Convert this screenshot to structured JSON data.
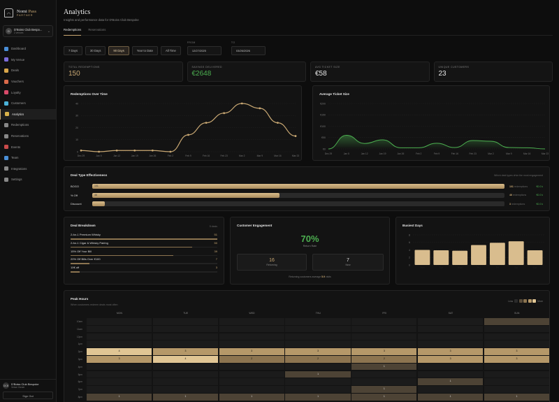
{
  "brand": {
    "name_a": "Nomi",
    "name_b": "Pass",
    "tag": "PARTNER"
  },
  "club": {
    "name": "D'Boiss Club Bespo...",
    "sub": "2 venues",
    "avatar": "D"
  },
  "nav": [
    {
      "label": "Dashboard",
      "color": "#4a8fd8"
    },
    {
      "label": "My Venue",
      "color": "#7b6cd9"
    },
    {
      "label": "Deals",
      "color": "#d9a64a"
    },
    {
      "label": "Vouchers",
      "color": "#d96a4a"
    },
    {
      "label": "Loyalty",
      "color": "#d94a6a"
    },
    {
      "label": "Customers",
      "color": "#4ab2d9"
    },
    {
      "label": "Analytics",
      "color": "#d9b24a",
      "active": true
    },
    {
      "label": "Redemptions",
      "color": "#888"
    },
    {
      "label": "Reservations",
      "color": "#888"
    },
    {
      "label": "Events",
      "color": "#c94a4a"
    },
    {
      "label": "Team",
      "color": "#4a8fd8"
    },
    {
      "label": "Integrations",
      "color": "#888"
    },
    {
      "label": "Settings",
      "color": "#888"
    }
  ],
  "user": {
    "initials": "DCB",
    "name": "D'Boiss Club Bespoke",
    "role": "Venue Owner",
    "signout": "Sign Out",
    "logo": "N"
  },
  "header": {
    "title": "Analytics",
    "subtitle": "Insights and performance data for D'Boiss Club Bespoke"
  },
  "tabs": [
    "Redemptions",
    "Reservations"
  ],
  "range_buttons": [
    "7 Days",
    "30 Days",
    "90 Days",
    "Year to Date",
    "All Time"
  ],
  "active_range": "90 Days",
  "date_from": {
    "label": "FROM",
    "value": "12/27/2025"
  },
  "date_to": {
    "label": "TO",
    "value": "03/26/2026"
  },
  "kpis": [
    {
      "label": "TOTAL REDEMPTIONS",
      "value": "150",
      "color": "#c9a873"
    },
    {
      "label": "SAVINGS DELIVERED",
      "value": "€2648",
      "color": "#4caf50"
    },
    {
      "label": "AVG TICKET SIZE",
      "value": "€58",
      "color": "#e8e8e8"
    },
    {
      "label": "UNIQUE CUSTOMERS",
      "value": "23",
      "color": "#e8e8e8"
    }
  ],
  "redemptions_title": "Redemptions Over Time",
  "ticket_title": "Average Ticket Size",
  "chart_data": [
    {
      "type": "line",
      "title": "Redemptions Over Time",
      "x": [
        "Dec 29",
        "Jan 5",
        "Jan 12",
        "Jan 19",
        "Jan 26",
        "Feb 2",
        "Feb 9",
        "Feb 16",
        "Feb 23",
        "Mar 2",
        "Mar 9",
        "Mar 16",
        "Mar 23"
      ],
      "y": [
        1,
        0,
        1,
        1,
        1,
        0,
        14,
        24,
        32,
        40,
        36,
        24,
        13
      ],
      "ylim": [
        0,
        40
      ],
      "yticks": [
        0,
        10,
        20,
        30,
        40
      ],
      "color": "#c9a873",
      "markers": true
    },
    {
      "type": "area",
      "title": "Average Ticket Size",
      "x": [
        "Dec 29",
        "Jan 5",
        "Jan 12",
        "Jan 19",
        "Jan 26",
        "Feb 2",
        "Feb 9",
        "Feb 16",
        "Feb 23",
        "Mar 2",
        "Mar 9",
        "Mar 16",
        "Mar 23"
      ],
      "y": [
        0,
        60,
        24,
        40,
        5,
        5,
        25,
        6,
        37,
        34,
        6,
        5,
        0
      ],
      "ylim": [
        0,
        200
      ],
      "ytick_labels": [
        "€0",
        "€50",
        "€100",
        "€150",
        "€200"
      ],
      "color": "#4caf50"
    },
    {
      "type": "bar",
      "title": "Busiest Days",
      "categories": [
        "Mon",
        "Tue",
        "Wed",
        "Thu",
        "Fri",
        "Sat",
        "Sun"
      ],
      "values": [
        4,
        3.9,
        3.8,
        5.3,
        5.9,
        6.3,
        3.9
      ],
      "ylim": [
        0,
        8
      ],
      "yticks": [
        0,
        2,
        4,
        6,
        8
      ],
      "color": "#d9bd8e"
    }
  ],
  "deal_effectiveness": {
    "title": "Deal Type Effectiveness",
    "note": "Which deal types drive the most engagement",
    "rows": [
      {
        "name": "BOGO",
        "count": "101",
        "label": "101",
        "fraction": 1.0,
        "meta": "redemptions",
        "revenue": "€0.0 k",
        "revenue_color": "#4caf50"
      },
      {
        "name": "% Off",
        "count": "46",
        "label": "46",
        "fraction": 0.455,
        "meta": "redemptions",
        "revenue": "€0.0 k",
        "revenue_color": "#4caf50"
      },
      {
        "name": "Discount",
        "count": "3",
        "label": "",
        "fraction": 0.03,
        "meta": "redemptions",
        "revenue": "€0.0 k",
        "revenue_color": "#4caf50"
      }
    ]
  },
  "deal_breakdown": {
    "title": "Deal Breakdown",
    "note": "5 deals",
    "rows": [
      {
        "name": "2-for-1 Premium Whisky",
        "count": "51",
        "fraction": 1.0
      },
      {
        "name": "2-for-1 Cigar & Whisky Pairing",
        "count": "50",
        "fraction": 0.83
      },
      {
        "name": "15% Off Your Bill",
        "count": "39",
        "fraction": 0.7
      },
      {
        "name": "20% Off Bills Over €100",
        "count": "7",
        "fraction": 0.13
      },
      {
        "name": "10€ off",
        "count": "3",
        "fraction": 0.06
      }
    ]
  },
  "engagement": {
    "title": "Customer Engagement",
    "rate": "70%",
    "rate_label": "Return Rate",
    "returning": "16",
    "returning_label": "Returning",
    "new": "7",
    "new_label": "New",
    "footer_a": "Returning customers average ",
    "footer_b": "5.9",
    "footer_c": " visits"
  },
  "busiest": {
    "title": "Busiest Days"
  },
  "peak": {
    "title": "Peak Hours",
    "sub": "When customers redeem deals most often",
    "legend_less": "Less",
    "legend_more": "More",
    "legend_colors": [
      "#2a2a2a",
      "#5a4d3a",
      "#8c7450",
      "#b89a6a",
      "#e0c594"
    ],
    "days": [
      "MON",
      "TUE",
      "WED",
      "THU",
      "FRI",
      "SAT",
      "SUN"
    ],
    "hours": [
      "10am",
      "11am",
      "12pm",
      "1pm",
      "2pm",
      "3pm",
      "4pm",
      "5pm",
      "6pm",
      "7pm",
      "8pm"
    ],
    "cells": [
      [
        0,
        0,
        0,
        0,
        0,
        0,
        1
      ],
      [
        0,
        0,
        0,
        0,
        0,
        0,
        0
      ],
      [
        0,
        0,
        0,
        0,
        0,
        0,
        0
      ],
      [
        0,
        0,
        0,
        0,
        0,
        0,
        0
      ],
      [
        4,
        3,
        3,
        3,
        3,
        3,
        3
      ],
      [
        3,
        4,
        2,
        2,
        2,
        3,
        3
      ],
      [
        0,
        0,
        0,
        0,
        1,
        0,
        0
      ],
      [
        0,
        0,
        0,
        1,
        0,
        0,
        0
      ],
      [
        0,
        0,
        0,
        0,
        0,
        1,
        0
      ],
      [
        0,
        0,
        0,
        0,
        1,
        0,
        0
      ],
      [
        1,
        1,
        1,
        1,
        1,
        1,
        1
      ]
    ],
    "cell_values": [
      [
        "",
        "",
        "",
        "",
        "",
        "",
        ""
      ],
      [
        "",
        "",
        "",
        "",
        "",
        "",
        ""
      ],
      [
        "",
        "",
        "",
        "",
        "",
        "",
        ""
      ],
      [
        "",
        "",
        "",
        "",
        "",
        "",
        ""
      ],
      [
        "4",
        "3",
        "3",
        "3",
        "3",
        "3",
        "3"
      ],
      [
        "3",
        "4",
        "2",
        "2",
        "2",
        "3",
        "3"
      ],
      [
        "",
        "",
        "",
        "",
        "1",
        "",
        ""
      ],
      [
        "",
        "",
        "",
        "1",
        "",
        "",
        ""
      ],
      [
        "",
        "",
        "",
        "",
        "",
        "1",
        ""
      ],
      [
        "",
        "",
        "",
        "",
        "1",
        "",
        ""
      ],
      [
        "1",
        "1",
        "1",
        "1",
        "1",
        "1",
        "1"
      ]
    ]
  }
}
